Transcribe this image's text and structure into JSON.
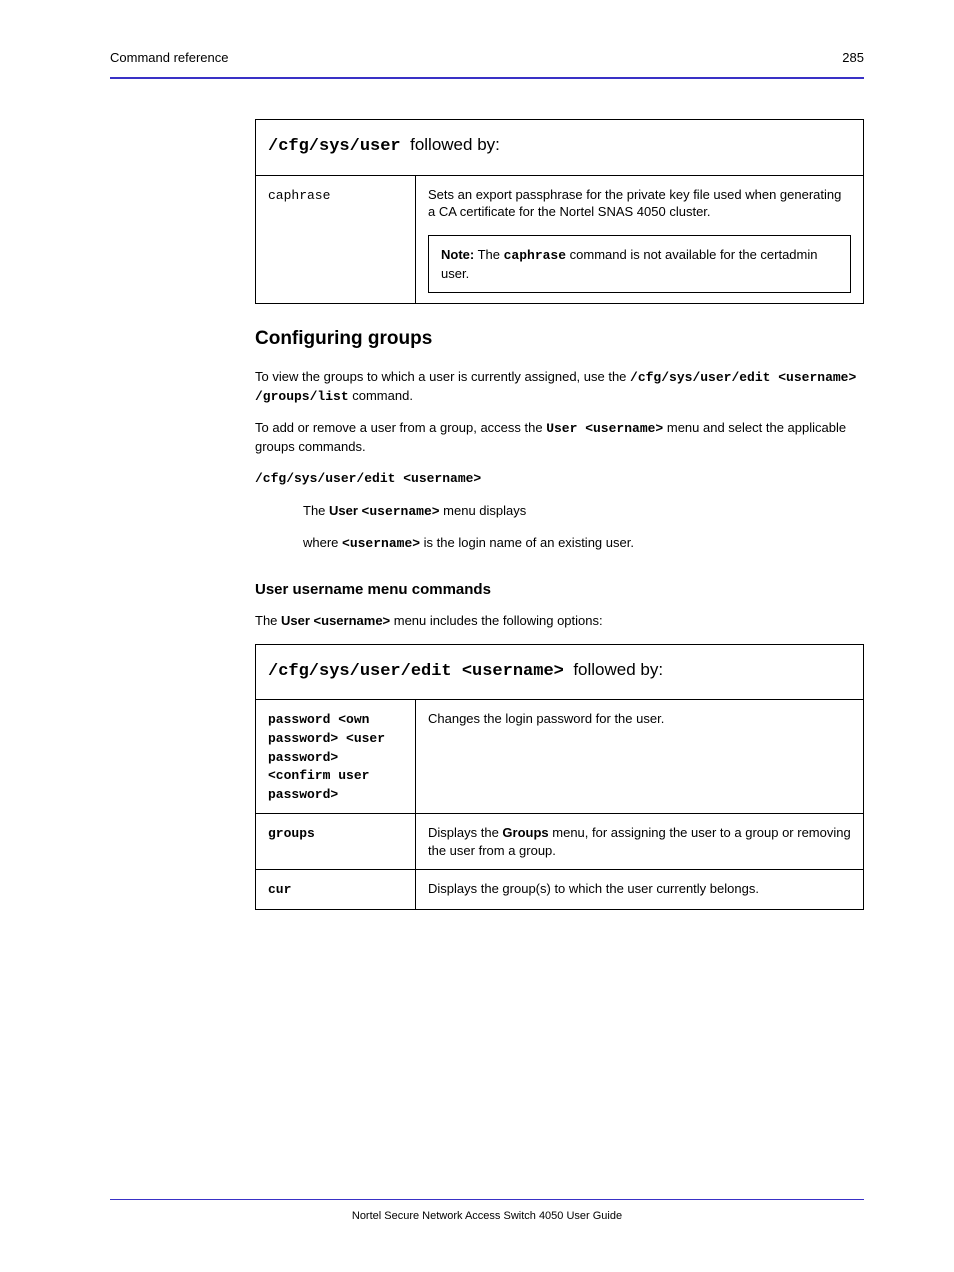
{
  "header": {
    "left": "Command reference",
    "right": "285"
  },
  "table1": {
    "title_prefix": "",
    "title_cmd": "/cfg/sys/user",
    "title_suffix_1": "followed by:",
    "row1": {
      "cmd": "caphrase",
      "desc_pre": "Sets an export passphrase for the private key file used when generating a CA certificate for the Nortel SNAS 4050 cluster.",
      "note_label": "Note:",
      "note_text": " The ",
      "note_cmd": "caphrase",
      "note_after": " command is not available for the certadmin user."
    }
  },
  "groups_section": {
    "heading": "Configuring groups",
    "p1_pre": "To view the groups to which a user is currently assigned, use the ",
    "p1_cmd": "/cfg/sys/user/edit <username> /groups/list",
    "p1_post": " command.",
    "p2_pre": "To add or remove a user from a group, access the ",
    "p2_bold": "User <username>",
    "p2_post": " menu and select the applicable groups commands.",
    "menu_cmd": "/cfg/sys/user/edit <username>",
    "menu_line2": "The ",
    "menu_line2_b": "User ",
    "menu_line2_var": "<username>",
    "menu_line2_c": " menu displays",
    "menu_line3": "where ",
    "menu_line3_var": "<username>",
    "menu_line3_post": " is the login name of an existing user."
  },
  "form_cmds": {
    "heading": "User username menu commands",
    "intro_pre": "The ",
    "intro_bold": "User <username> ",
    "intro_post": "menu includes the following options:"
  },
  "table2": {
    "title_cmd": "/cfg/sys/user/edit <username>",
    "title_suffix": "followed by:",
    "rows": [
      {
        "cmd": "password <own password> <user password> <confirm user password>",
        "desc": "Changes the login password for the user."
      },
      {
        "cmd": "groups",
        "desc_pre": "Displays the ",
        "desc_bold": "Groups",
        "desc_post": " menu, for assigning the user to a group or removing the user from a group."
      },
      {
        "cmd": "cur",
        "desc": "Displays the group(s) to which the user currently belongs."
      }
    ]
  },
  "footer": {
    "left": "",
    "center": "Nortel Secure Network Access Switch 4050 User Guide",
    "right": ""
  }
}
